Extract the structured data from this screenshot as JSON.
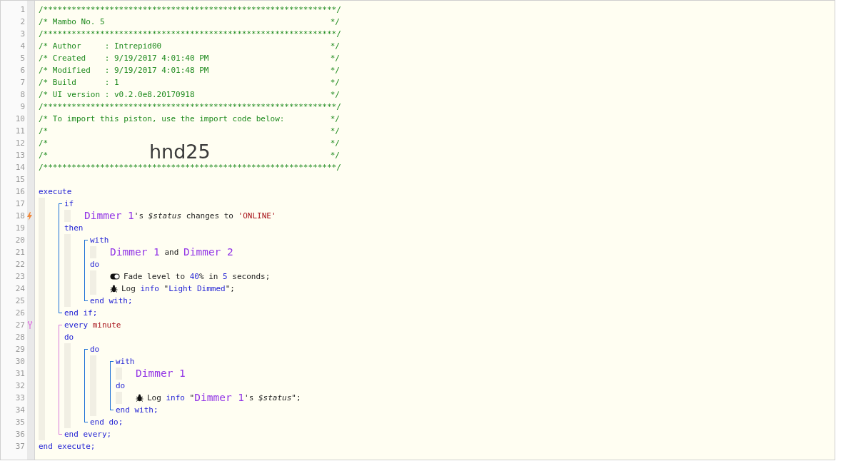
{
  "editor": {
    "lines": [
      {
        "kind": "banner",
        "number": "1",
        "text": "/**************************************************************/"
      },
      {
        "kind": "comment",
        "number": "2",
        "left": "/* Mambo No. 5",
        "right": "*/"
      },
      {
        "kind": "banner",
        "number": "3",
        "text": "/**************************************************************/"
      },
      {
        "kind": "comment",
        "number": "4",
        "left": "/* Author     : Intrepid00",
        "right": "*/"
      },
      {
        "kind": "comment",
        "number": "5",
        "left": "/* Created    : 9/19/2017 4:01:40 PM",
        "right": "*/"
      },
      {
        "kind": "comment",
        "number": "6",
        "left": "/* Modified   : 9/19/2017 4:01:48 PM",
        "right": "*/"
      },
      {
        "kind": "comment",
        "number": "7",
        "left": "/* Build      : 1",
        "right": "*/"
      },
      {
        "kind": "comment",
        "number": "8",
        "left": "/* UI version : v0.2.0e8.20170918",
        "right": "*/"
      },
      {
        "kind": "banner",
        "number": "9",
        "text": "/**************************************************************/"
      },
      {
        "kind": "comment",
        "number": "10",
        "left": "/* To import this piston, use the import code below:",
        "right": "*/"
      },
      {
        "kind": "comment",
        "number": "11",
        "left": "/*",
        "right": "*/"
      },
      {
        "kind": "comment",
        "number": "12",
        "left": "/*",
        "right": "*/"
      },
      {
        "kind": "comment",
        "number": "13",
        "left": "/*",
        "import_code": "hnd25",
        "right": "*/"
      },
      {
        "kind": "banner",
        "number": "14",
        "text": "/**************************************************************/"
      },
      {
        "kind": "blank",
        "number": "15"
      },
      {
        "kind": "code",
        "number": "16",
        "tokens": [
          {
            "kind": "keyword",
            "text": "execute"
          }
        ],
        "children": [
          {
            "kind": "statement",
            "color": "#1a6fd6",
            "lines": [
              {
                "kind": "code",
                "number": "17",
                "tokens": [
                  {
                    "kind": "keyword",
                    "text": "if"
                  }
                ],
                "children": [
                  {
                    "kind": "code",
                    "number": "18",
                    "marker": {
                      "kind": "trigger"
                    },
                    "tokens": [
                      {
                        "kind": "device",
                        "text": "Dimmer 1"
                      },
                      {
                        "kind": "plain",
                        "text": "'s "
                      },
                      {
                        "kind": "variable",
                        "text": "$status"
                      },
                      {
                        "kind": "plain",
                        "text": " changes to "
                      },
                      {
                        "kind": "string",
                        "text": "'ONLINE'"
                      }
                    ]
                  }
                ]
              },
              {
                "kind": "code",
                "number": "19",
                "tokens": [
                  {
                    "kind": "keyword",
                    "text": "then"
                  }
                ],
                "children": [
                  {
                    "kind": "statement",
                    "color": "#1a6fd6",
                    "lines": [
                      {
                        "kind": "code",
                        "number": "20",
                        "tokens": [
                          {
                            "kind": "keyword",
                            "text": "with"
                          }
                        ],
                        "children": [
                          {
                            "kind": "code",
                            "number": "21",
                            "tokens": [
                              {
                                "kind": "device",
                                "text": "Dimmer 1"
                              },
                              {
                                "kind": "plain",
                                "text": " and "
                              },
                              {
                                "kind": "device",
                                "text": "Dimmer 2"
                              }
                            ]
                          }
                        ]
                      },
                      {
                        "kind": "code",
                        "number": "22",
                        "tokens": [
                          {
                            "kind": "keyword",
                            "text": "do"
                          }
                        ],
                        "children": [
                          {
                            "kind": "level_action",
                            "number": "23",
                            "tokens": [
                              {
                                "kind": "plain",
                                "text": "Fade level to "
                              },
                              {
                                "kind": "value",
                                "text": "40"
                              },
                              {
                                "kind": "plain",
                                "text": "% in "
                              },
                              {
                                "kind": "value",
                                "text": "5"
                              },
                              {
                                "kind": "plain",
                                "text": " seconds;"
                              }
                            ]
                          },
                          {
                            "kind": "log_action",
                            "number": "24",
                            "tokens": [
                              {
                                "kind": "plain",
                                "text": "Log "
                              },
                              {
                                "kind": "value",
                                "text": "info"
                              },
                              {
                                "kind": "plain",
                                "text": " \""
                              },
                              {
                                "kind": "value",
                                "text": "Light Dimmed"
                              },
                              {
                                "kind": "plain",
                                "text": "\";"
                              }
                            ]
                          }
                        ]
                      },
                      {
                        "kind": "code",
                        "number": "25",
                        "tokens": [
                          {
                            "kind": "keyword",
                            "text": "end with;"
                          }
                        ]
                      }
                    ]
                  }
                ]
              },
              {
                "kind": "code",
                "number": "26",
                "tokens": [
                  {
                    "kind": "keyword",
                    "text": "end if;"
                  }
                ]
              }
            ]
          },
          {
            "kind": "statement",
            "color": "#d97ad9",
            "lines": [
              {
                "kind": "code",
                "number": "27",
                "marker": {
                  "kind": "timer"
                },
                "tokens": [
                  {
                    "kind": "keyword",
                    "text": "every "
                  },
                  {
                    "kind": "unit",
                    "text": "minute"
                  }
                ]
              },
              {
                "kind": "code",
                "number": "28",
                "tokens": [
                  {
                    "kind": "keyword",
                    "text": "do"
                  }
                ],
                "children": [
                  {
                    "kind": "statement",
                    "color": "#1a6fd6",
                    "lines": [
                      {
                        "kind": "code",
                        "number": "29",
                        "tokens": [
                          {
                            "kind": "keyword",
                            "text": "do"
                          }
                        ],
                        "children": [
                          {
                            "kind": "statement",
                            "color": "#1a6fd6",
                            "lines": [
                              {
                                "kind": "code",
                                "number": "30",
                                "tokens": [
                                  {
                                    "kind": "keyword",
                                    "text": "with"
                                  }
                                ],
                                "children": [
                                  {
                                    "kind": "code",
                                    "number": "31",
                                    "tokens": [
                                      {
                                        "kind": "device",
                                        "text": "Dimmer 1"
                                      }
                                    ]
                                  }
                                ]
                              },
                              {
                                "kind": "code",
                                "number": "32",
                                "tokens": [
                                  {
                                    "kind": "keyword",
                                    "text": "do"
                                  }
                                ],
                                "children": [
                                  {
                                    "kind": "log_action",
                                    "number": "33",
                                    "tokens": [
                                      {
                                        "kind": "plain",
                                        "text": "Log "
                                      },
                                      {
                                        "kind": "value",
                                        "text": "info"
                                      },
                                      {
                                        "kind": "plain",
                                        "text": " \""
                                      },
                                      {
                                        "kind": "device",
                                        "text": "Dimmer 1"
                                      },
                                      {
                                        "kind": "plain",
                                        "text": "'s "
                                      },
                                      {
                                        "kind": "variable",
                                        "text": "$status"
                                      },
                                      {
                                        "kind": "plain",
                                        "text": "\";"
                                      }
                                    ]
                                  }
                                ]
                              },
                              {
                                "kind": "code",
                                "number": "34",
                                "tokens": [
                                  {
                                    "kind": "keyword",
                                    "text": "end with;"
                                  }
                                ]
                              }
                            ]
                          }
                        ]
                      },
                      {
                        "kind": "code",
                        "number": "35",
                        "tokens": [
                          {
                            "kind": "keyword",
                            "text": "end do;"
                          }
                        ]
                      }
                    ]
                  }
                ]
              },
              {
                "kind": "code",
                "number": "36",
                "tokens": [
                  {
                    "kind": "keyword",
                    "text": "end every;"
                  }
                ]
              }
            ]
          }
        ]
      },
      {
        "kind": "code",
        "number": "37",
        "tokens": [
          {
            "kind": "keyword",
            "text": "end execute;"
          }
        ]
      }
    ]
  }
}
